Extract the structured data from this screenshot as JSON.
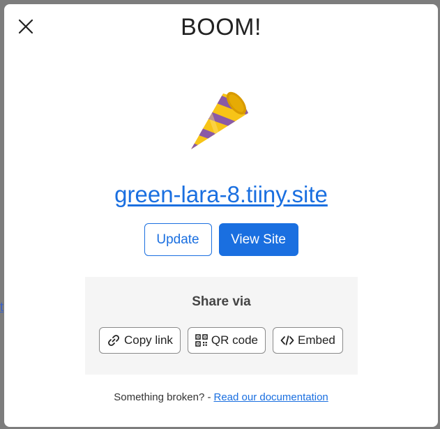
{
  "modal": {
    "title": "BOOM!",
    "site_link": "green-lara-8.tiiny.site",
    "buttons": {
      "update": "Update",
      "view_site": "View Site"
    },
    "share": {
      "title": "Share via",
      "copy_link": "Copy link",
      "qr_code": "QR code",
      "embed": "Embed"
    },
    "footer": {
      "text": "Something broken? -",
      "link": "Read our documentation"
    },
    "icons": {
      "close": "close-icon",
      "party": "party-popper-icon",
      "link": "link-icon",
      "qr": "qr-code-icon",
      "embed": "code-icon"
    },
    "colors": {
      "accent": "#1a6fe0",
      "share_bg": "#f5f5f5"
    }
  },
  "background": {
    "partial_link": "t"
  }
}
